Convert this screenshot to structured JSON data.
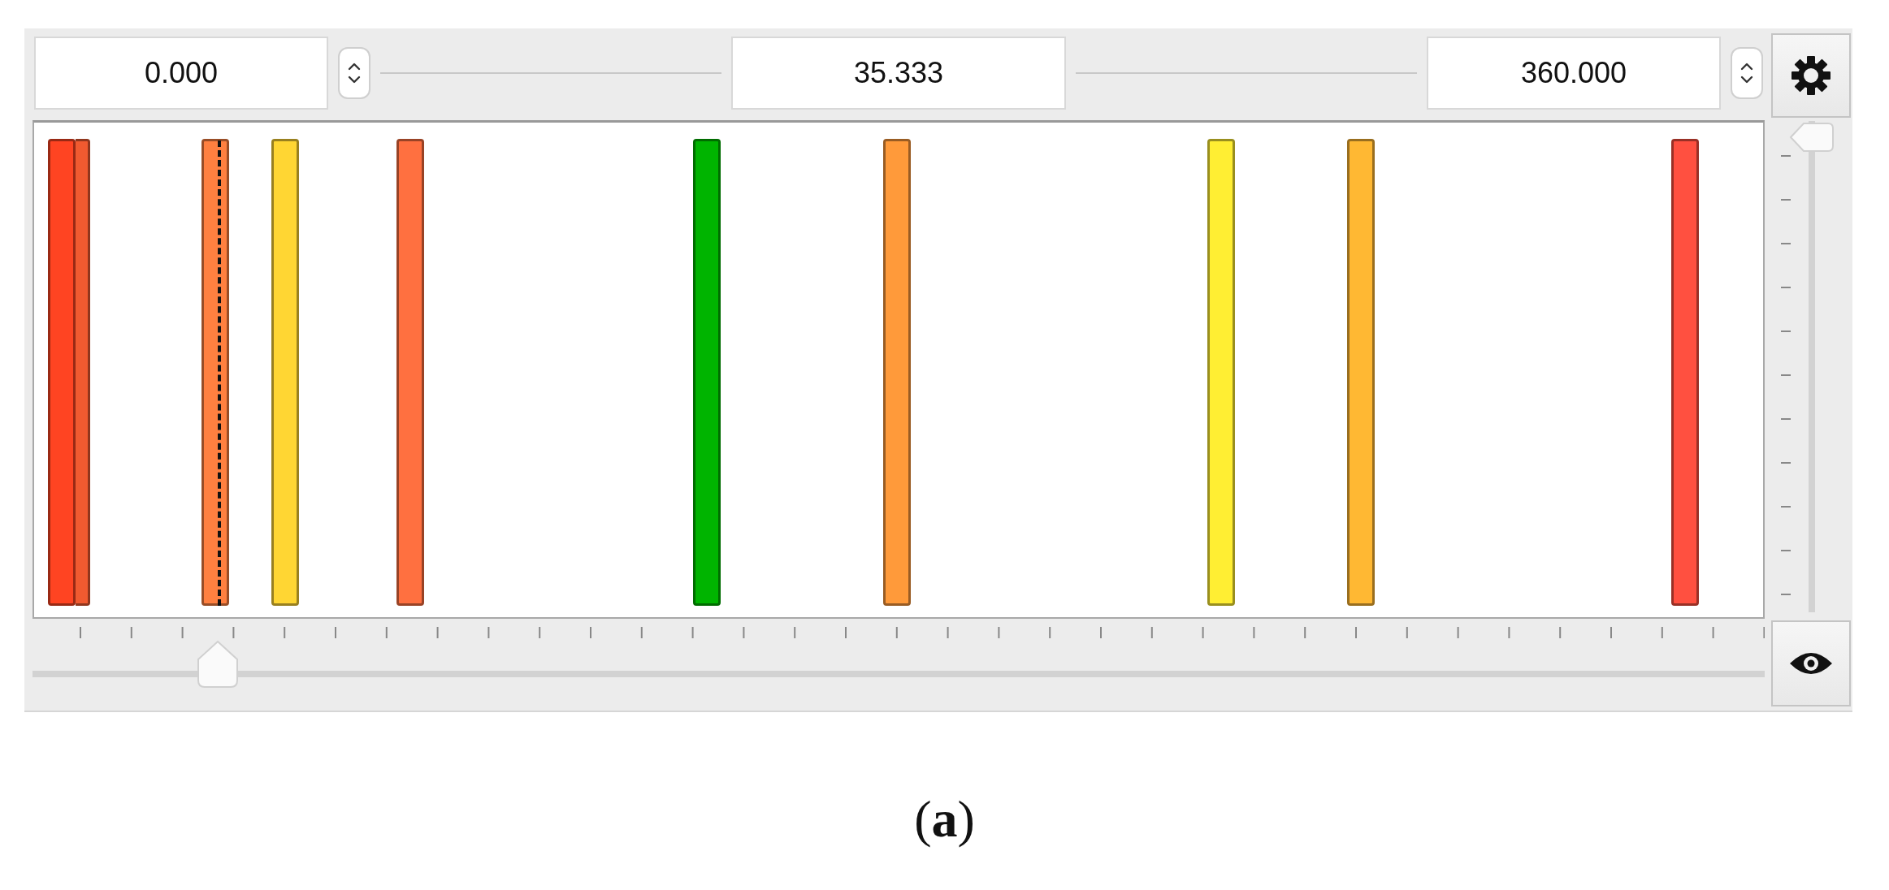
{
  "range": {
    "min": "0.000",
    "current": "35.333",
    "max": "360.000"
  },
  "bars": [
    {
      "color": "#f05a30"
    },
    {
      "color": "#ff4422"
    },
    {
      "color": "#ff8040"
    },
    {
      "color": "#ffd633"
    },
    {
      "color": "#ff7040"
    },
    {
      "color": "#00b400"
    },
    {
      "color": "#ff9a3a"
    },
    {
      "color": "#ffee33"
    },
    {
      "color": "#ffb833"
    },
    {
      "color": "#ff5040"
    }
  ],
  "position_slider": {
    "level": 0.107
  },
  "zoom_slider": {
    "level": 1.0
  },
  "caption": "(**a**)"
}
